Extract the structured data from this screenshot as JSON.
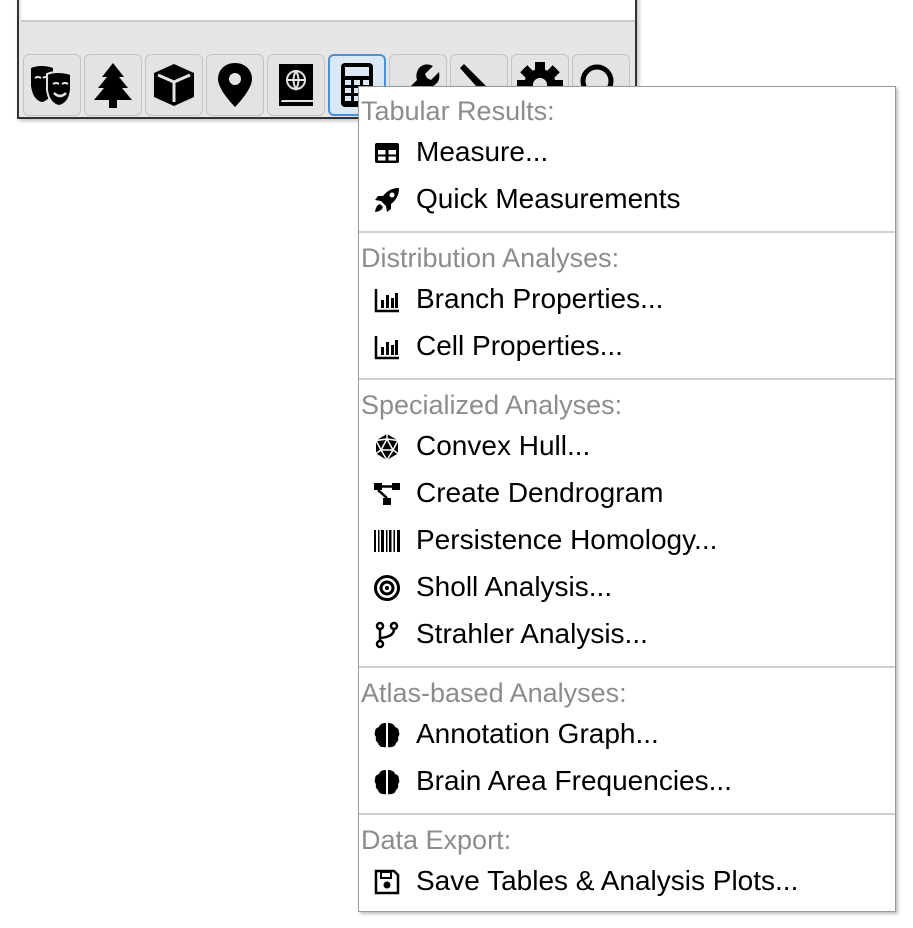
{
  "toolbar": {
    "buttons": [
      {
        "icon": "theater-masks-icon",
        "active": false
      },
      {
        "icon": "tree-icon",
        "active": false
      },
      {
        "icon": "cube-icon",
        "active": false
      },
      {
        "icon": "map-marker-icon",
        "active": false
      },
      {
        "icon": "atlas-icon",
        "active": false
      },
      {
        "icon": "calculator-icon",
        "active": true
      },
      {
        "icon": "wrench-icon",
        "active": false
      },
      {
        "icon": "pen-icon",
        "active": false
      },
      {
        "icon": "gear-icon",
        "active": false
      },
      {
        "icon": "search-icon",
        "active": false
      }
    ],
    "active_color": "#4a90d9"
  },
  "menu": {
    "sections": [
      {
        "header": "Tabular Results:",
        "items": [
          {
            "label": "Measure...",
            "icon": "table-icon"
          },
          {
            "label": "Quick Measurements",
            "icon": "rocket-icon"
          }
        ]
      },
      {
        "header": "Distribution Analyses:",
        "items": [
          {
            "label": "Branch Properties...",
            "icon": "bar-chart-icon"
          },
          {
            "label": "Cell Properties...",
            "icon": "bar-chart-icon"
          }
        ]
      },
      {
        "header": "Specialized Analyses:",
        "items": [
          {
            "label": "Convex Hull...",
            "icon": "dice-d20-icon"
          },
          {
            "label": "Create Dendrogram",
            "icon": "project-diagram-icon"
          },
          {
            "label": "Persistence Homology...",
            "icon": "barcode-icon"
          },
          {
            "label": "Sholl Analysis...",
            "icon": "bullseye-icon"
          },
          {
            "label": "Strahler Analysis...",
            "icon": "code-branch-icon"
          }
        ]
      },
      {
        "header": "Atlas-based Analyses:",
        "items": [
          {
            "label": "Annotation Graph...",
            "icon": "brain-icon"
          },
          {
            "label": "Brain Area Frequencies...",
            "icon": "brain-icon"
          }
        ]
      },
      {
        "header": "Data Export:",
        "items": [
          {
            "label": "Save Tables & Analysis Plots...",
            "icon": "save-icon"
          }
        ]
      }
    ]
  }
}
